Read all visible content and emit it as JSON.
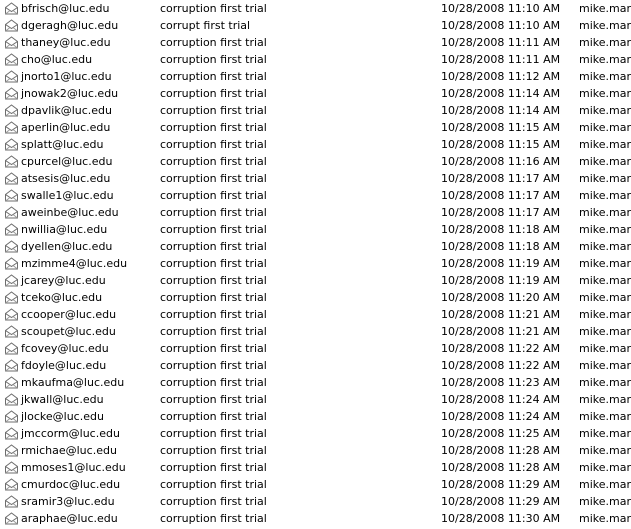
{
  "icon": "read-envelope-icon",
  "rows": [
    {
      "from": "bfrisch@luc.edu",
      "subject": "corruption first trial",
      "date": "10/28/2008 11:10 AM",
      "user": "mike.mars"
    },
    {
      "from": "dgeragh@luc.edu",
      "subject": "corrupt first trial",
      "date": "10/28/2008 11:10 AM",
      "user": "mike.mars"
    },
    {
      "from": "thaney@luc.edu",
      "subject": "corruption first trial",
      "date": "10/28/2008 11:11 AM",
      "user": "mike.mars"
    },
    {
      "from": "cho@luc.edu",
      "subject": "corruption first trial",
      "date": "10/28/2008 11:11 AM",
      "user": "mike.mars"
    },
    {
      "from": "jnorto1@luc.edu",
      "subject": "corruption first trial",
      "date": "10/28/2008 11:12 AM",
      "user": "mike.mars"
    },
    {
      "from": "jnowak2@luc.edu",
      "subject": "corruption first trial",
      "date": "10/28/2008 11:14 AM",
      "user": "mike.mars"
    },
    {
      "from": "dpavlik@luc.edu",
      "subject": "corruption first trial",
      "date": "10/28/2008 11:14 AM",
      "user": "mike.mars"
    },
    {
      "from": "aperlin@luc.edu",
      "subject": "corruption first trial",
      "date": "10/28/2008 11:15 AM",
      "user": "mike.mars"
    },
    {
      "from": "splatt@luc.edu",
      "subject": "corruption first trial",
      "date": "10/28/2008 11:15 AM",
      "user": "mike.mars"
    },
    {
      "from": "cpurcel@luc.edu",
      "subject": "corruption first trial",
      "date": "10/28/2008 11:16 AM",
      "user": "mike.mars"
    },
    {
      "from": "atsesis@luc.edu",
      "subject": "corruption first trial",
      "date": "10/28/2008 11:17 AM",
      "user": "mike.mars"
    },
    {
      "from": "swalle1@luc.edu",
      "subject": "corruption first trial",
      "date": "10/28/2008 11:17 AM",
      "user": "mike.mars"
    },
    {
      "from": "aweinbe@luc.edu",
      "subject": "corruption first trial",
      "date": "10/28/2008 11:17 AM",
      "user": "mike.mars"
    },
    {
      "from": "nwillia@luc.edu",
      "subject": "corruption first trial",
      "date": "10/28/2008 11:18 AM",
      "user": "mike.mars"
    },
    {
      "from": "dyellen@luc.edu",
      "subject": "corruption first trial",
      "date": "10/28/2008 11:18 AM",
      "user": "mike.mars"
    },
    {
      "from": "mzimme4@luc.edu",
      "subject": "corruption first trial",
      "date": "10/28/2008 11:19 AM",
      "user": "mike.mars"
    },
    {
      "from": "jcarey@luc.edu",
      "subject": "corruption first trial",
      "date": "10/28/2008 11:19 AM",
      "user": "mike.mars"
    },
    {
      "from": "tceko@luc.edu",
      "subject": "corruption first trial",
      "date": "10/28/2008 11:20 AM",
      "user": "mike.mars"
    },
    {
      "from": "ccooper@luc.edu",
      "subject": "corruption first trial",
      "date": "10/28/2008 11:21 AM",
      "user": "mike.mars"
    },
    {
      "from": "scoupet@luc.edu",
      "subject": "corruption first trial",
      "date": "10/28/2008 11:21 AM",
      "user": "mike.mars"
    },
    {
      "from": "fcovey@luc.edu",
      "subject": "corruption first trial",
      "date": "10/28/2008 11:22 AM",
      "user": "mike.mars"
    },
    {
      "from": "fdoyle@luc.edu",
      "subject": "corruption first trial",
      "date": "10/28/2008 11:22 AM",
      "user": "mike.mars"
    },
    {
      "from": "mkaufma@luc.edu",
      "subject": "corruption first trial",
      "date": "10/28/2008 11:23 AM",
      "user": "mike.mars"
    },
    {
      "from": "jkwall@luc.edu",
      "subject": "corruption first trial",
      "date": "10/28/2008 11:24 AM",
      "user": "mike.mars"
    },
    {
      "from": "jlocke@luc.edu",
      "subject": "corruption first trial",
      "date": "10/28/2008 11:24 AM",
      "user": "mike.mars"
    },
    {
      "from": "jmccorm@luc.edu",
      "subject": "corruption first trial",
      "date": "10/28/2008 11:25 AM",
      "user": "mike.mars"
    },
    {
      "from": "rmichae@luc.edu",
      "subject": "corruption first trial",
      "date": "10/28/2008 11:28 AM",
      "user": "mike.mars"
    },
    {
      "from": "mmoses1@luc.edu",
      "subject": "corruption first trial",
      "date": "10/28/2008 11:28 AM",
      "user": "mike.mars"
    },
    {
      "from": "cmurdoc@luc.edu",
      "subject": "corruption first trial",
      "date": "10/28/2008 11:29 AM",
      "user": "mike.mars"
    },
    {
      "from": "sramir3@luc.edu",
      "subject": "corruption first trial",
      "date": "10/28/2008 11:29 AM",
      "user": "mike.mars"
    },
    {
      "from": "araphae@luc.edu",
      "subject": "corruption first trial",
      "date": "10/28/2008 11:30 AM",
      "user": "mike.mars"
    }
  ]
}
